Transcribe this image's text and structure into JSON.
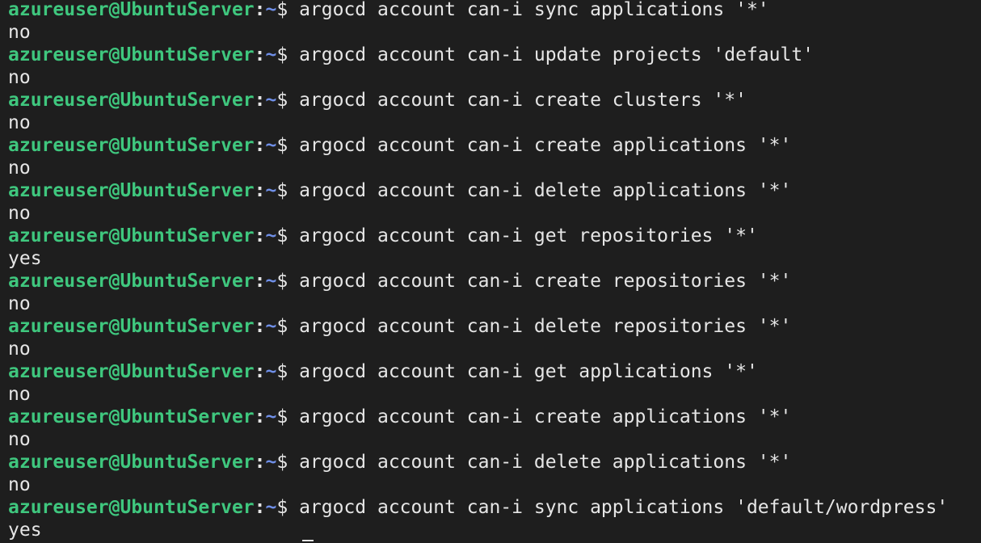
{
  "prompt": {
    "user_host": "azureuser@UbuntuServer",
    "separator": ":",
    "path": "~",
    "symbol": "$ "
  },
  "history": [
    {
      "command": "argocd account can-i sync applications '*'",
      "output": "no"
    },
    {
      "command": "argocd account can-i update projects 'default'",
      "output": "no"
    },
    {
      "command": "argocd account can-i create clusters '*'",
      "output": "no"
    },
    {
      "command": "argocd account can-i create applications '*'",
      "output": "no"
    },
    {
      "command": "argocd account can-i delete applications '*'",
      "output": "no"
    },
    {
      "command": "argocd account can-i get repositories '*'",
      "output": "yes"
    },
    {
      "command": "argocd account can-i create repositories '*'",
      "output": "no"
    },
    {
      "command": "argocd account can-i delete repositories '*'",
      "output": "no"
    },
    {
      "command": "argocd account can-i get applications '*'",
      "output": "no"
    },
    {
      "command": "argocd account can-i create applications '*'",
      "output": "no"
    },
    {
      "command": "argocd account can-i delete applications '*'",
      "output": "no"
    },
    {
      "command": "argocd account can-i sync applications 'default/wordpress'",
      "output": "yes"
    }
  ],
  "colors": {
    "background": "#1e1e1e",
    "user_host": "#3fc77e",
    "path": "#6f8fe8",
    "text": "#e6e6e6"
  }
}
